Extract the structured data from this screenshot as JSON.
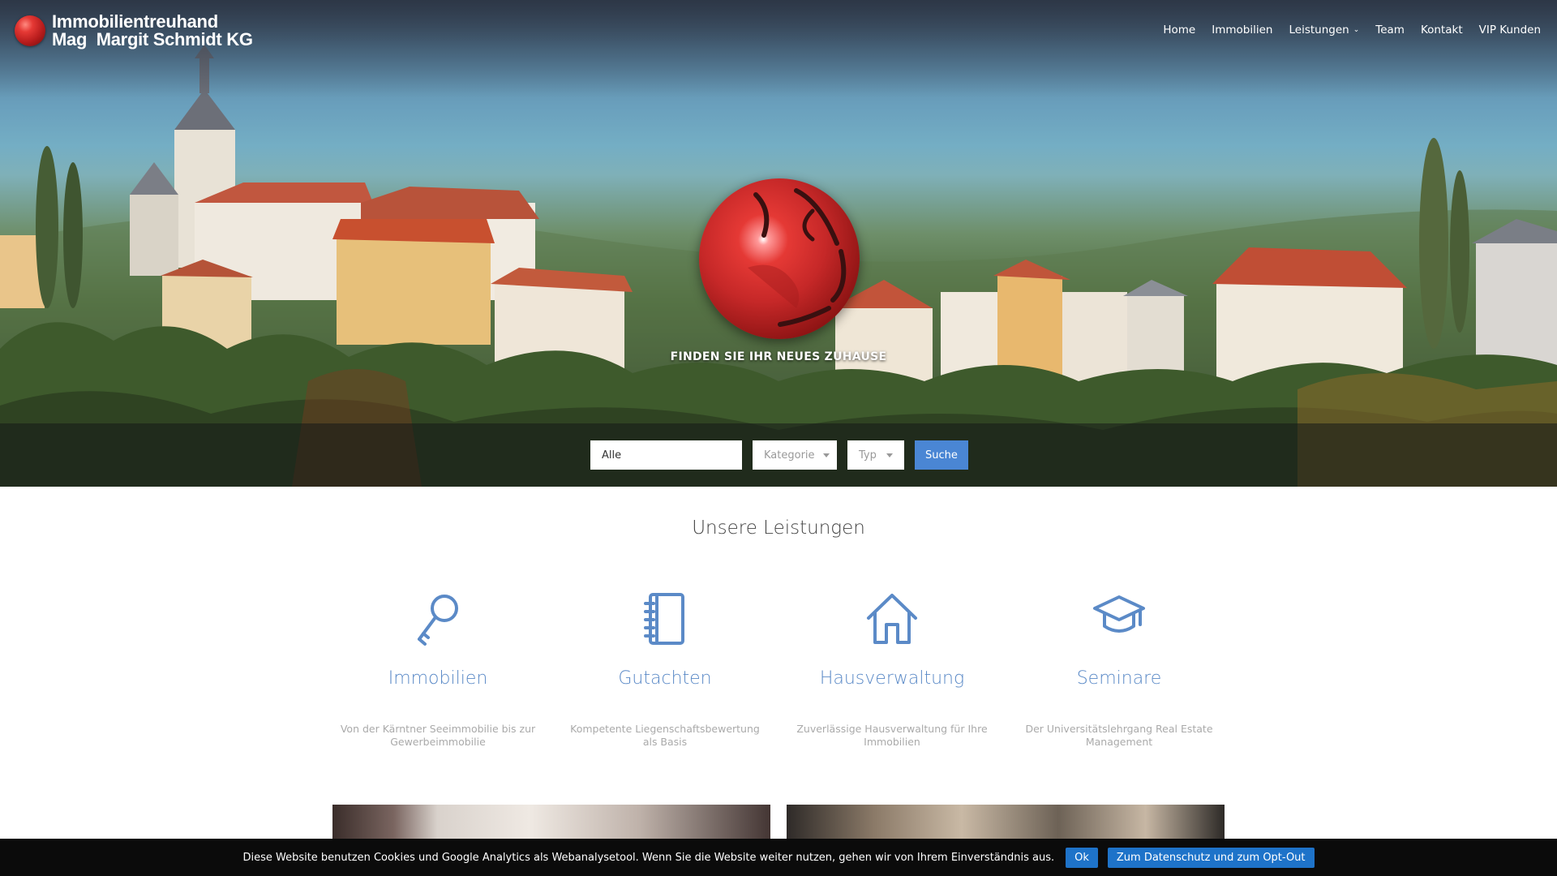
{
  "brand": {
    "line1": "Immobilientreuhand",
    "line2": "Mag  Margit Schmidt KG",
    "logo_icon": "red-globe-icon"
  },
  "nav": {
    "items": [
      {
        "label": "Home"
      },
      {
        "label": "Immobilien"
      },
      {
        "label": "Leistungen",
        "has_dropdown": true
      },
      {
        "label": "Team"
      },
      {
        "label": "Kontakt"
      },
      {
        "label": "VIP Kunden"
      }
    ]
  },
  "hero": {
    "tagline": "FINDEN SIE IHR NEUES ZUHAUSE",
    "emblem_icon": "red-globe-icon"
  },
  "search": {
    "input_value": "Alle",
    "category_label": "Kategorie",
    "type_label": "Typ",
    "submit_label": "Suche"
  },
  "services": {
    "title": "Unsere Leistungen",
    "accent": "#5b8ac7",
    "items": [
      {
        "icon": "key-icon",
        "title": "Immobilien",
        "desc": "Von der Kärntner Seeimmobilie bis zur Gewerbeimmobilie"
      },
      {
        "icon": "notebook-icon",
        "title": "Gutachten",
        "desc": "Kompetente Liegenschaftsbewertung als Basis"
      },
      {
        "icon": "house-icon",
        "title": "Hausverwaltung",
        "desc": "Zuverlässige Hausverwaltung für Ihre Immobilien"
      },
      {
        "icon": "graduation-cap-icon",
        "title": "Seminare",
        "desc": "Der Universitätslehrgang Real Estate Management"
      }
    ]
  },
  "cookie": {
    "text": "Diese Website benutzen Cookies und Google Analytics als Webanalysetool. Wenn Sie die Website weiter nutzen, gehen wir von Ihrem Einverständnis aus.",
    "ok_label": "Ok",
    "privacy_label": "Zum Datenschutz und zum Opt-Out",
    "button_color": "#1e73c9"
  }
}
